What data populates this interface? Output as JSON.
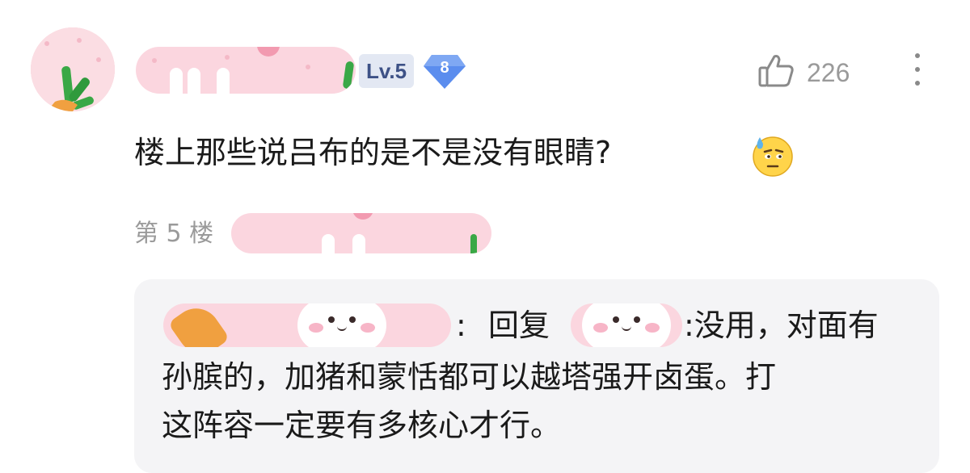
{
  "comment": {
    "level_badge": "Lv.5",
    "fan_badge": "8",
    "like_count": "226",
    "text": "楼上那些说吕布的是不是没有眼睛?",
    "floor": "第 5 楼"
  },
  "reply": {
    "separator": ":",
    "reply_word": "回复",
    "line1_rest": ":没用，对面有",
    "line2": "孙膑的，加猪和蒙恬都可以越塔强开卤蛋。打",
    "line3": "这阵容一定要有多核心才行。"
  },
  "icons": {
    "like": "thumbs-up-icon",
    "more": "more-vertical-icon",
    "emoji": "sweat-emoji-icon"
  },
  "colors": {
    "level_badge_bg": "#e3e8f3",
    "level_badge_text": "#3d5186",
    "fan_badge": "#5b8dee",
    "muted_text": "#9a9a9a",
    "reply_bg": "#f4f4f6"
  }
}
